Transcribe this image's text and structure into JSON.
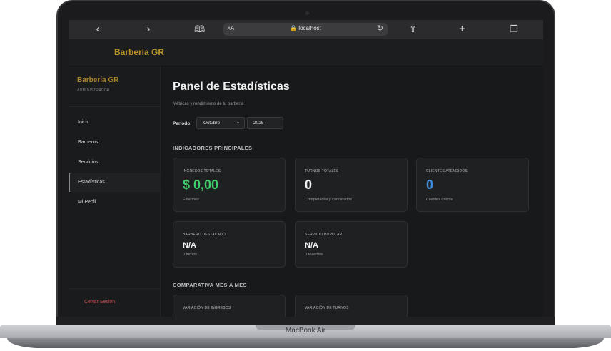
{
  "device": {
    "model_label": "MacBook Air"
  },
  "browser": {
    "back_icon": "chevron-left",
    "forward_icon": "chevron-right",
    "reader_text": "ᴀA",
    "url": "localhost",
    "lock_icon": "lock",
    "reload_icon": "reload",
    "share_icon": "share",
    "new_tab_icon": "plus",
    "tabs_icon": "tabs"
  },
  "header": {
    "brand": "Barbería GR"
  },
  "sidebar": {
    "brand": "Barbería GR",
    "role": "ADMINISTRADOR",
    "items": [
      {
        "label": "Inicio"
      },
      {
        "label": "Barberos"
      },
      {
        "label": "Servicios"
      },
      {
        "label": "Estadísticas"
      },
      {
        "label": "Mi Perfil"
      }
    ],
    "logout": "Cerrar Sesión"
  },
  "main": {
    "title": "Panel de Estadísticas",
    "subtitle": "Métricas y rendimiento de tu barbería",
    "period_label": "Período:",
    "month": "Octubre",
    "year": "2025",
    "section_indicators": "INDICADORES PRINCIPALES",
    "cards": [
      {
        "label": "INGRESOS TOTALES",
        "value": "$ 0,00",
        "note": "Este mes",
        "color": "#3fcf6a"
      },
      {
        "label": "TURNOS TOTALES",
        "value": "0",
        "note": "Completados y cancelados",
        "color": "#f2f2f2"
      },
      {
        "label": "CLIENTES ATENDIDOS",
        "value": "0",
        "note": "Clientes únicos",
        "color": "#3b8fe0"
      },
      {
        "label": "BARBERO DESTACADO",
        "value": "N/A",
        "note": "0 turnos",
        "color": "#f2f2f2"
      },
      {
        "label": "SERVICIO POPULAR",
        "value": "N/A",
        "note": "0 reservas",
        "color": "#f2f2f2"
      }
    ],
    "section_comparison": "COMPARATIVA MES A MES",
    "compare_cards": [
      {
        "label": "VARIACIÓN DE INGRESOS"
      },
      {
        "label": "VARIACIÓN DE TURNOS"
      }
    ]
  }
}
